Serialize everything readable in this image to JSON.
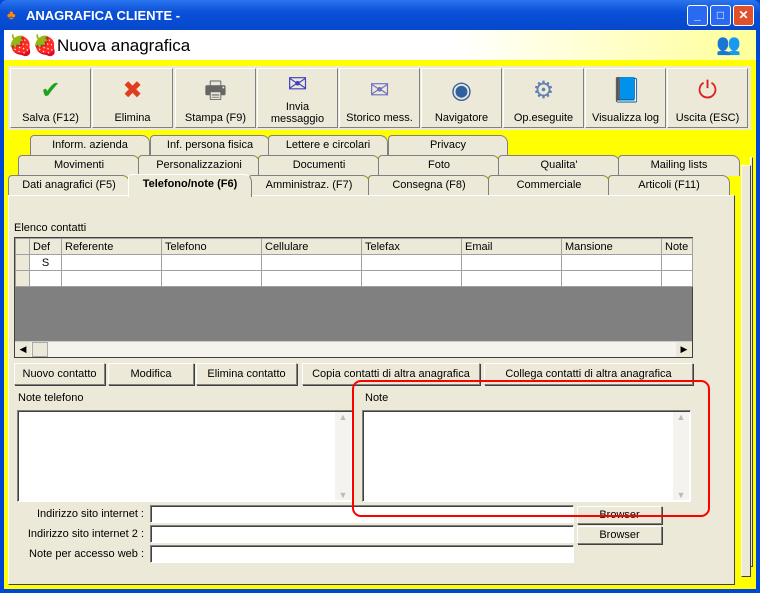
{
  "window": {
    "title": "ANAGRAFICA CLIENTE -",
    "controls": [
      "_",
      "□",
      "✕"
    ]
  },
  "header": {
    "title": "Nuova anagrafica"
  },
  "toolbar": [
    {
      "label": "Salva (F12)",
      "icon": "check-icon",
      "glyph": "✔",
      "color": "#1fa31f"
    },
    {
      "label": "Elimina",
      "icon": "x-icon",
      "glyph": "✖",
      "color": "#e03c20"
    },
    {
      "label": "Stampa (F9)",
      "icon": "printer-icon",
      "glyph": "🖶",
      "color": "#666666"
    },
    {
      "label": "Invia messaggio",
      "icon": "envelope-pen-icon",
      "glyph": "✉",
      "color": "#4040c0"
    },
    {
      "label": "Storico mess.",
      "icon": "envelope-search-icon",
      "glyph": "✉",
      "color": "#7070c0"
    },
    {
      "label": "Navigatore",
      "icon": "compass-icon",
      "glyph": "◉",
      "color": "#3060a0"
    },
    {
      "label": "Op.eseguite",
      "icon": "gears-icon",
      "glyph": "⚙",
      "color": "#6080b0"
    },
    {
      "label": "Visualizza log",
      "icon": "book-search-icon",
      "glyph": "📘",
      "color": "#2050c0"
    },
    {
      "label": "Uscita (ESC)",
      "icon": "power-icon",
      "glyph": "⏻",
      "color": "#e02020"
    }
  ],
  "tabs": {
    "row1": [
      "Inform. azienda",
      "Inf. persona fisica",
      "Lettere e circolari",
      "Privacy"
    ],
    "row2": [
      "Movimenti",
      "Personalizzazioni",
      "Documenti",
      "Foto",
      "Qualita'",
      "Mailing lists"
    ],
    "row3": [
      "Dati anagrafici (F5)",
      "Telefono/note (F6)",
      "Amministraz. (F7)",
      "Consegna (F8)",
      "Commerciale",
      "Articoli (F11)"
    ],
    "selected": "Telefono/note (F6)"
  },
  "contacts": {
    "label": "Elenco contatti",
    "columns": [
      "Def",
      "Referente",
      "Telefono",
      "Cellulare",
      "Telefax",
      "Email",
      "Mansione",
      "Note"
    ],
    "rows": [
      [
        "S",
        "",
        "",
        "",
        "",
        "",
        "",
        ""
      ]
    ]
  },
  "buttons": {
    "new": "Nuovo contatto",
    "edit": "Modifica",
    "delete": "Elimina contatto",
    "copy": "Copia contatti di altra anagrafica",
    "link": "Collega contatti di altra anagrafica"
  },
  "notes": {
    "phone_label": "Note telefono",
    "note_label": "Note",
    "phone_value": "",
    "note_value": ""
  },
  "web": {
    "site1_label": "Indirizzo sito internet :",
    "site1_value": "",
    "site2_label": "Indirizzo sito internet 2 :",
    "site2_value": "",
    "access_label": "Note per accesso web :",
    "access_value": "",
    "browser": "Browser"
  },
  "highlight_color": "#ff0000"
}
